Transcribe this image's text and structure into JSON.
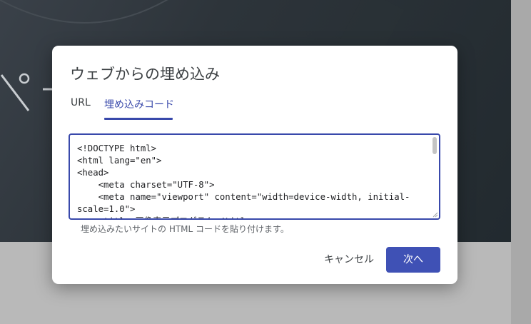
{
  "dialog": {
    "title": "ウェブからの埋め込み",
    "tabs": [
      {
        "label": "URL",
        "active": false
      },
      {
        "label": "埋め込みコード",
        "active": true
      }
    ],
    "code_value": "<!DOCTYPE html>\n<html lang=\"en\">\n<head>\n    <meta charset=\"UTF-8\">\n    <meta name=\"viewport\" content=\"width=device-width, initial-scale=1.0\">\n    <title>画像表示プログラム</title>",
    "helper_text": "埋め込みたいサイトの HTML コードを貼り付けます。",
    "cancel_label": "キャンセル",
    "next_label": "次へ"
  },
  "colors": {
    "accent": "#3949ab",
    "primary_button": "#3f51b5"
  }
}
